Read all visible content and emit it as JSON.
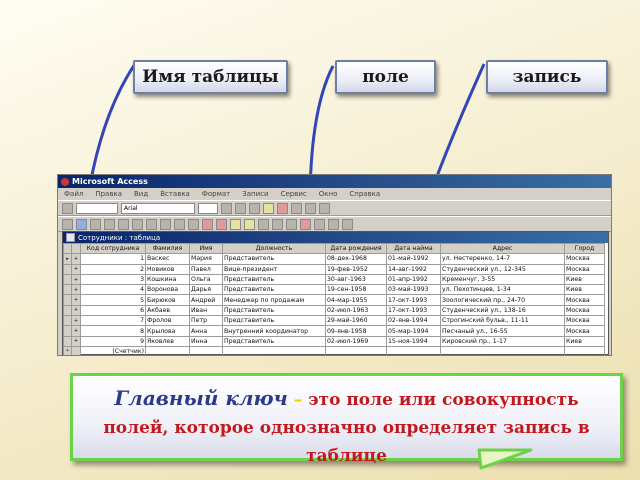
{
  "callouts": {
    "table_name": "Имя таблицы",
    "field": "поле",
    "record": "запись"
  },
  "window": {
    "title": "Microsoft Access",
    "menu": [
      "Файл",
      "Правка",
      "Вид",
      "Вставка",
      "Формат",
      "Записи",
      "Сервис",
      "Окно",
      "Справка"
    ],
    "combo_value": "Arial",
    "subwindow_title": "Сотрудники : таблица"
  },
  "table": {
    "columns": [
      "Код сотрудника",
      "Фамилия",
      "Имя",
      "Должность",
      "Дата рождения",
      "Дата найма",
      "Адрес",
      "Город"
    ],
    "rows": [
      [
        "1",
        "Васкес",
        "Мария",
        "Представитель",
        "08-дек-1968",
        "01-май-1992",
        "ул. Нестеренко, 14-7",
        "Москва"
      ],
      [
        "2",
        "Новиков",
        "Павел",
        "Вице-президент",
        "19-фев-1952",
        "14-авг-1992",
        "Студенческий ул., 12-345",
        "Москва"
      ],
      [
        "3",
        "Кошкина",
        "Ольга",
        "Представитель",
        "30-авг-1963",
        "01-апр-1992",
        "Кременчуг, 3-55",
        "Киев"
      ],
      [
        "4",
        "Воронова",
        "Дарья",
        "Представитель",
        "19-сен-1958",
        "03-май-1993",
        "ул. Пехотинцев, 1-34",
        "Киев"
      ],
      [
        "5",
        "Бирюков",
        "Андрей",
        "Менеджер по продажам",
        "04-мар-1955",
        "17-окт-1993",
        "Зоологический пр., 24-70",
        "Москва"
      ],
      [
        "6",
        "Акбаев",
        "Иван",
        "Представитель",
        "02-июл-1963",
        "17-окт-1993",
        "Студенческий ул., 138-16",
        "Москва"
      ],
      [
        "7",
        "Фролов",
        "Петр",
        "Представитель",
        "29-май-1960",
        "02-янв-1994",
        "Строгинский бульв., 11-11",
        "Москва"
      ],
      [
        "8",
        "Крылова",
        "Анна",
        "Внутренний координатор",
        "09-янв-1958",
        "05-мар-1994",
        "Песчаный ул., 16-55",
        "Москва"
      ],
      [
        "9",
        "Яковлев",
        "Инна",
        "Представитель",
        "02-июл-1969",
        "15-ноя-1994",
        "Кировский пр., 1-17",
        "Киев"
      ]
    ],
    "new_row_label": "(Счетчик)"
  },
  "definition": {
    "term": "Главный ключ",
    "dash": " – ",
    "text": "это поле или совокупность полей, которое однозначно определяет запись в таблице"
  },
  "colors": {
    "callout_border": "#6d7fa8",
    "pointer_line": "#3346b5",
    "definition_border": "#6fd14a",
    "definition_text": "#c2181f",
    "term_text": "#2b3a8c"
  }
}
